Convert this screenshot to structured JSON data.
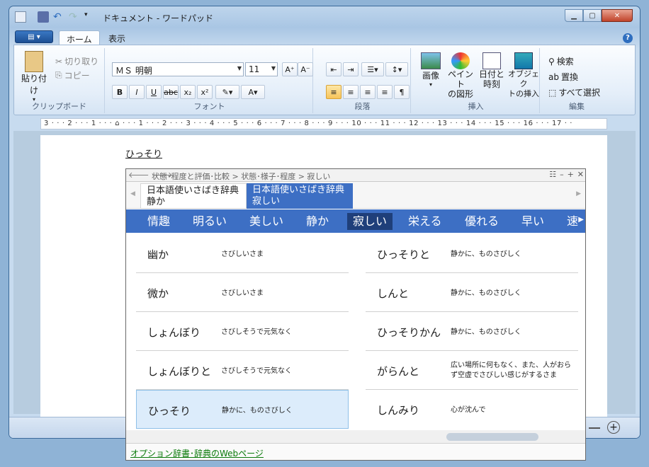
{
  "window": {
    "title": "ドキュメント - ワードパッド",
    "tabs": [
      "ホーム",
      "表示"
    ]
  },
  "ribbon": {
    "clipboard": {
      "paste": "貼り付け",
      "cut": "切り取り",
      "copy": "コピー",
      "label": "クリップボード"
    },
    "font": {
      "name": "ＭＳ 明朝",
      "size": "11",
      "label": "フォント"
    },
    "paragraph": {
      "label": "段落"
    },
    "insert": {
      "picture": "画像",
      "paint": "ペイント\nの図形",
      "datetime": "日付と\n時刻",
      "object": "オブジェク\nトの挿入",
      "label": "挿入"
    },
    "edit": {
      "find": "検索",
      "replace": "置換",
      "selectall": "すべて選択",
      "label": "編集"
    }
  },
  "ruler": "3 · · · 2 · · · 1 · · · ⌂ · · · 1 · · · 2 · · · 3 · · · 4 · · · 5 · · · 6 · · · 7 · · · 8 · · · 9 · · · 10 · · · 11 · · · 12 · · · 13 · · · 14 · · · 15 · · · 16 · · · 17 · ·",
  "document": {
    "text": "ひっそり"
  },
  "dictionary": {
    "breadcrumb": "状態･程度と評価･比較 > 状態･様子･程度 > 寂しい",
    "tabs": [
      {
        "line1": "日本語使いさばき辞典",
        "line2": "静か"
      },
      {
        "line1": "日本語使いさばき辞典",
        "line2": "寂しい"
      }
    ],
    "words": [
      "情趣",
      "明るい",
      "美しい",
      "静か",
      "寂しい",
      "栄える",
      "優れる",
      "早い",
      "速"
    ],
    "selected_word": "寂しい",
    "left_entries": [
      {
        "word": "幽か",
        "desc": "さびしいさま"
      },
      {
        "word": "微か",
        "desc": "さびしいさま"
      },
      {
        "word": "しょんぼり",
        "desc": "さびしそうで元気なく"
      },
      {
        "word": "しょんぼりと",
        "desc": "さびしそうで元気なく"
      },
      {
        "word": "ひっそり",
        "desc": "静かに、ものさびしく"
      }
    ],
    "right_entries": [
      {
        "word": "ひっそりと",
        "desc": "静かに、ものさびしく"
      },
      {
        "word": "しんと",
        "desc": "静かに、ものさびしく"
      },
      {
        "word": "ひっそりかん",
        "desc": "静かに、ものさびしく"
      },
      {
        "word": "がらんと",
        "desc": "広い場所に何もなく、また、人がおらず空虚でさびしい感じがするさま"
      },
      {
        "word": "しんみり",
        "desc": "心が沈んで"
      }
    ],
    "footer_link": "オプション辞書･辞典のWebページ"
  }
}
